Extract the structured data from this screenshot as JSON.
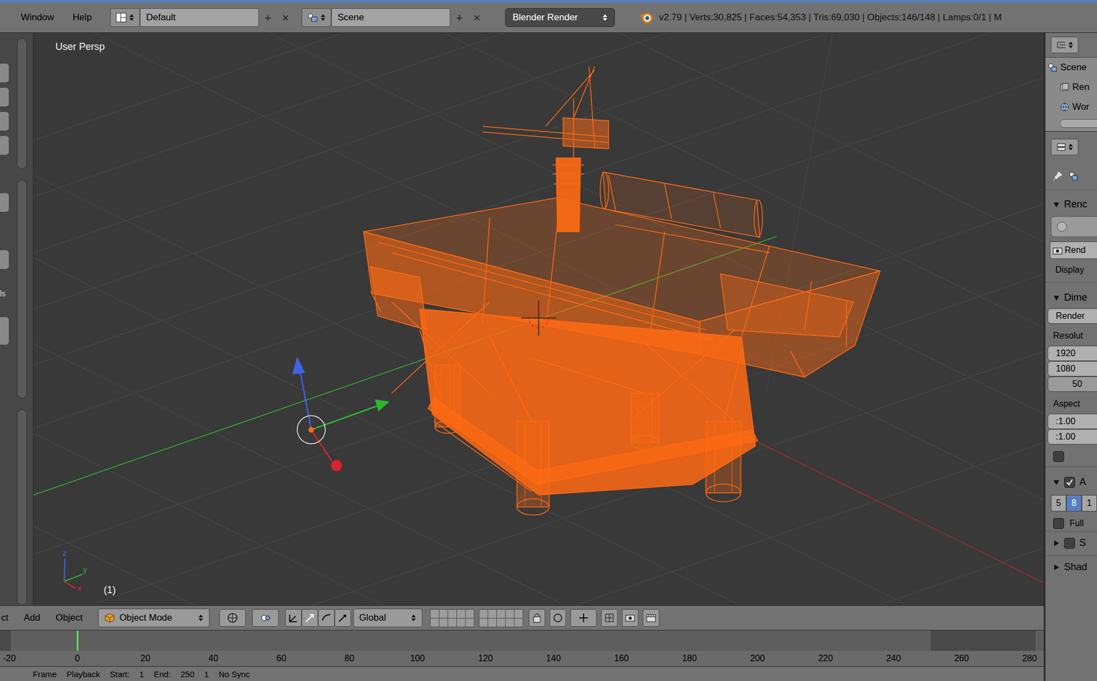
{
  "top_bar": {
    "menus": [
      "Window",
      "Help"
    ],
    "layout": {
      "name": "Default",
      "add": "+",
      "remove": "×"
    },
    "scene": {
      "name": "Scene",
      "add": "+",
      "remove": "×"
    },
    "engine": "Blender Render",
    "stats": "v2.79 | Verts:30,825 | Faces:54,353 | Tris:69,030 | Objects:146/148 | Lamps:0/1 | M"
  },
  "tool_shelf": {
    "tab_label": "ls"
  },
  "viewport": {
    "view": "User Persp",
    "frame": "(1)",
    "axes": [
      {
        "label": "z",
        "color": "#3f63e6"
      },
      {
        "label": "y",
        "color": "#2fb82f"
      },
      {
        "label": "x",
        "color": "#d8232f"
      }
    ]
  },
  "view3d_header": {
    "menus": [
      "ct",
      "Add",
      "Object"
    ],
    "mode": "Object Mode",
    "orientation": "Global"
  },
  "timeline": {
    "ticks": [
      "-20",
      "0",
      "20",
      "40",
      "60",
      "80",
      "100",
      "120",
      "140",
      "160",
      "180",
      "200",
      "220",
      "240",
      "260",
      "280"
    ],
    "current_frame": "0"
  },
  "playback_bar": {
    "items": [
      "Frame",
      "Playback",
      "Start:",
      "1",
      "End:",
      "250",
      "1",
      "No Sync"
    ]
  },
  "outliner": {
    "items": [
      {
        "label": "Scene",
        "kind": "scene"
      },
      {
        "label": "Ren",
        "kind": "render"
      },
      {
        "label": "Wor",
        "kind": "world"
      }
    ]
  },
  "properties": {
    "render_panel": {
      "title": "Renc",
      "expanded": true,
      "render_button": "Rend",
      "display_label": "Display"
    },
    "dimensions_panel": {
      "title": "Dime",
      "expanded": true,
      "preset": "Render",
      "resolution_label": "Resolut",
      "resolution_x": "1920",
      "resolution_y": "1080",
      "percentage": "50",
      "aspect_label": "Aspect",
      "aspect_x": ":1.00",
      "aspect_y": ":1.00",
      "border_checked": false
    },
    "antialiasing_panel": {
      "title": "A",
      "expanded": true,
      "enabled": true,
      "samples": [
        {
          "label": "5",
          "selected": false
        },
        {
          "label": "8",
          "selected": true
        },
        {
          "label": "1",
          "selected": false
        }
      ],
      "full_sample": {
        "label": "Full",
        "checked": false
      }
    },
    "collapsed_panels": [
      {
        "title": "S",
        "expanded": false,
        "has_checkbox": true,
        "checked": false
      },
      {
        "title": "Shad",
        "expanded": false,
        "has_checkbox": false,
        "checked": false
      }
    ]
  }
}
